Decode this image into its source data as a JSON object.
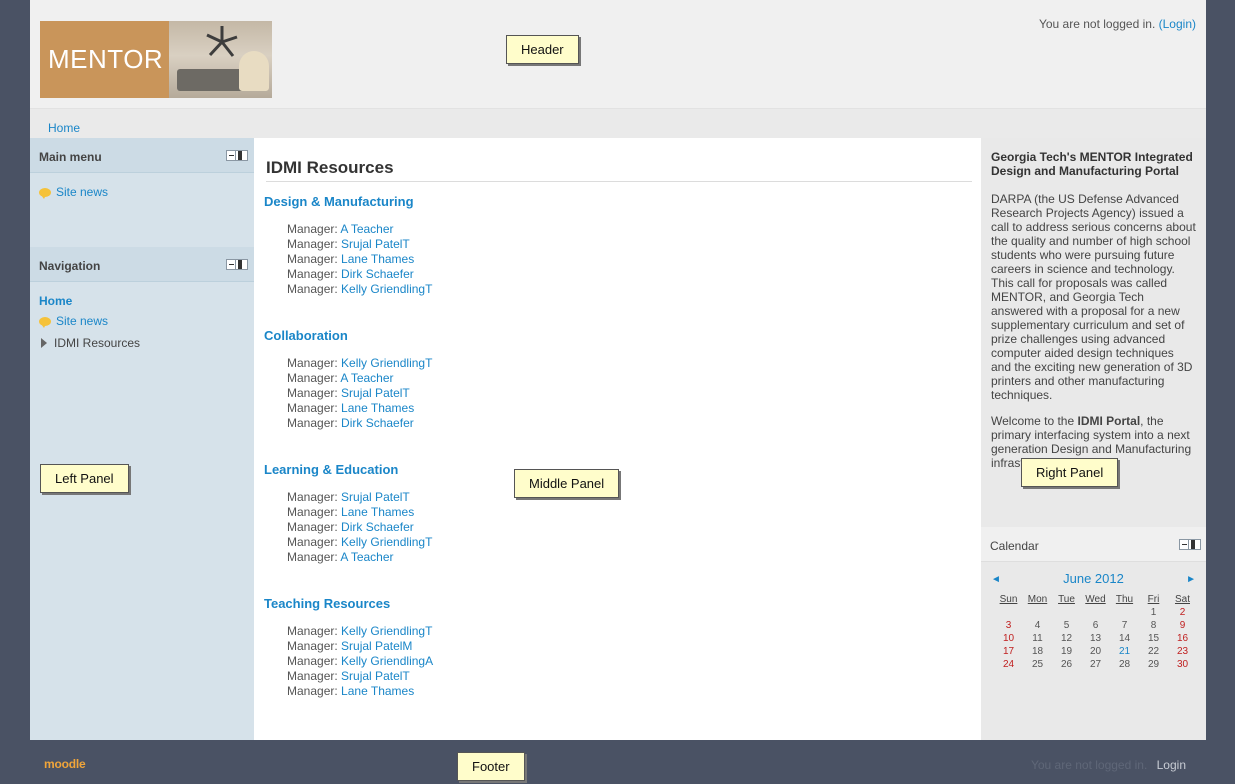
{
  "header": {
    "logo_text": "MENTOR",
    "login_text": "You are not logged in.",
    "login_link": "(Login)"
  },
  "navbar": {
    "home": "Home"
  },
  "main_menu": {
    "title": "Main menu",
    "items": [
      {
        "label": "Site news",
        "icon": "news-bubble-icon"
      }
    ]
  },
  "navigation": {
    "title": "Navigation",
    "home": "Home",
    "site_news": "Site news",
    "idmi_resources": "IDMI Resources"
  },
  "middle": {
    "title": "IDMI Resources",
    "manager_label": "Manager:",
    "courses": [
      {
        "name": "Design & Manufacturing",
        "managers": [
          "A Teacher",
          "Srujal PatelT",
          "Lane Thames",
          "Dirk Schaefer",
          "Kelly GriendlingT"
        ]
      },
      {
        "name": "Collaboration",
        "managers": [
          "Kelly GriendlingT",
          "A Teacher",
          "Srujal PatelT",
          "Lane Thames",
          "Dirk Schaefer"
        ]
      },
      {
        "name": "Learning & Education",
        "managers": [
          "Srujal PatelT",
          "Lane Thames",
          "Dirk Schaefer",
          "Kelly GriendlingT",
          "A Teacher"
        ]
      },
      {
        "name": "Teaching Resources",
        "managers": [
          "Kelly GriendlingT",
          "Srujal PatelM",
          "Kelly GriendlingA",
          "Srujal PatelT",
          "Lane Thames"
        ]
      }
    ]
  },
  "right": {
    "portal_title": "Georgia Tech's MENTOR Integrated Design and Manufacturing Portal",
    "portal_para1": "DARPA (the US Defense Advanced Research Projects Agency) issued a call to address serious concerns about the quality and number of high school students who were pursuing future careers in science and technology. This call for proposals was called MENTOR, and Georgia Tech answered with a proposal for a new supplementary curriculum and set of prize challenges using advanced computer aided design techniques and the exciting new generation of 3D printers and other manufacturing techniques.",
    "portal_para2_a": "Welcome to the",
    "portal_para2_bold": "IDMI Portal",
    "portal_para2_b": ", the primary interfacing system into a next generation Design and Manufacturing infrastructure."
  },
  "calendar": {
    "title": "Calendar",
    "month": "June 2012",
    "prev": "◄",
    "next": "►",
    "weekdays": [
      "Sun",
      "Mon",
      "Tue",
      "Wed",
      "Thu",
      "Fri",
      "Sat"
    ],
    "weeks": [
      [
        "",
        "",
        "",
        "",
        "",
        "1",
        "2"
      ],
      [
        "3",
        "4",
        "5",
        "6",
        "7",
        "8",
        "9"
      ],
      [
        "10",
        "11",
        "12",
        "13",
        "14",
        "15",
        "16"
      ],
      [
        "17",
        "18",
        "19",
        "20",
        "21",
        "22",
        "23"
      ],
      [
        "24",
        "25",
        "26",
        "27",
        "28",
        "29",
        "30"
      ]
    ],
    "today": "21"
  },
  "footer": {
    "logo": "moodle",
    "login_text": "You are not logged in.",
    "login_link": "Login"
  },
  "annotations": {
    "header": "Header",
    "left_panel": "Left Panel",
    "middle_panel": "Middle Panel",
    "right_panel": "Right Panel",
    "footer": "Footer"
  }
}
